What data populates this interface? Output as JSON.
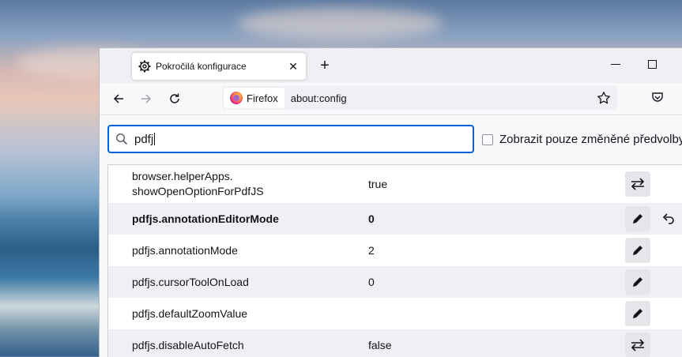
{
  "tab": {
    "title": "Pokročilá konfigurace",
    "close_glyph": "✕"
  },
  "newtab_glyph": "+",
  "navbar": {
    "identity_label": "Firefox",
    "url": "about:config"
  },
  "search": {
    "value": "pdfj",
    "checkbox_label": "Zobrazit pouze změněné předvolby"
  },
  "prefs": [
    {
      "name_line1": "browser.helperApps.",
      "name_line2": "showOpenOptionForPdfJS",
      "value": "true",
      "action": "toggle-icon",
      "modified": false
    },
    {
      "name": "pdfjs.annotationEditorMode",
      "value": "0",
      "action": "edit-icon",
      "modified": true
    },
    {
      "name": "pdfjs.annotationMode",
      "value": "2",
      "action": "edit-icon",
      "modified": false
    },
    {
      "name": "pdfjs.cursorToolOnLoad",
      "value": "0",
      "action": "edit-icon",
      "modified": false
    },
    {
      "name": "pdfjs.defaultZoomValue",
      "value": "",
      "action": "edit-icon",
      "modified": false
    },
    {
      "name": "pdfjs.disableAutoFetch",
      "value": "false",
      "action": "toggle-icon",
      "modified": false
    }
  ],
  "colors": {
    "accent": "#0061e0",
    "row_alt": "#f0f0f4",
    "button_bg": "#e6e6ea"
  }
}
